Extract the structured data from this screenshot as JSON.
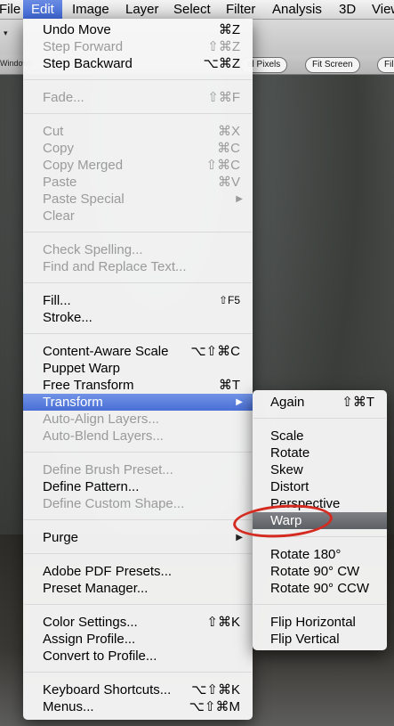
{
  "menubar": {
    "items": [
      "File",
      "Edit",
      "Image",
      "Layer",
      "Select",
      "Filter",
      "Analysis",
      "3D",
      "View"
    ],
    "active": "Edit"
  },
  "optbar": {
    "arrow": "▾",
    "window_label": "Windows",
    "actual_pixels": "al Pixels",
    "fit_screen": "Fit Screen",
    "fill_screen": "Fill"
  },
  "edit_menu": [
    {
      "label": "Undo Move",
      "shortcut": "⌘Z",
      "disabled": false
    },
    {
      "label": "Step Forward",
      "shortcut": "⇧⌘Z",
      "disabled": true
    },
    {
      "label": "Step Backward",
      "shortcut": "⌥⌘Z",
      "disabled": false
    },
    {
      "label": "Fade...",
      "shortcut": "⇧⌘F",
      "disabled": true
    },
    {
      "label": "Cut",
      "shortcut": "⌘X",
      "disabled": true
    },
    {
      "label": "Copy",
      "shortcut": "⌘C",
      "disabled": true
    },
    {
      "label": "Copy Merged",
      "shortcut": "⇧⌘C",
      "disabled": true
    },
    {
      "label": "Paste",
      "shortcut": "⌘V",
      "disabled": true
    },
    {
      "label": "Paste Special",
      "shortcut": "",
      "disabled": true
    },
    {
      "label": "Clear",
      "shortcut": "",
      "disabled": true
    },
    {
      "label": "Check Spelling...",
      "shortcut": "",
      "disabled": true
    },
    {
      "label": "Find and Replace Text...",
      "shortcut": "",
      "disabled": true
    },
    {
      "label": "Fill...",
      "shortcut": "⇧F5",
      "disabled": false
    },
    {
      "label": "Stroke...",
      "shortcut": "",
      "disabled": false
    },
    {
      "label": "Content-Aware Scale",
      "shortcut": "⌥⇧⌘C",
      "disabled": false
    },
    {
      "label": "Puppet Warp",
      "shortcut": "",
      "disabled": false
    },
    {
      "label": "Free Transform",
      "shortcut": "⌘T",
      "disabled": false
    },
    {
      "label": "Transform",
      "shortcut": "",
      "disabled": false
    },
    {
      "label": "Auto-Align Layers...",
      "shortcut": "",
      "disabled": true
    },
    {
      "label": "Auto-Blend Layers...",
      "shortcut": "",
      "disabled": true
    },
    {
      "label": "Define Brush Preset...",
      "shortcut": "",
      "disabled": true
    },
    {
      "label": "Define Pattern...",
      "shortcut": "",
      "disabled": false
    },
    {
      "label": "Define Custom Shape...",
      "shortcut": "",
      "disabled": true
    },
    {
      "label": "Purge",
      "shortcut": "",
      "disabled": false
    },
    {
      "label": "Adobe PDF Presets...",
      "shortcut": "",
      "disabled": false
    },
    {
      "label": "Preset Manager...",
      "shortcut": "",
      "disabled": false
    },
    {
      "label": "Color Settings...",
      "shortcut": "⇧⌘K",
      "disabled": false
    },
    {
      "label": "Assign Profile...",
      "shortcut": "",
      "disabled": false
    },
    {
      "label": "Convert to Profile...",
      "shortcut": "",
      "disabled": false
    },
    {
      "label": "Keyboard Shortcuts...",
      "shortcut": "⌥⇧⌘K",
      "disabled": false
    },
    {
      "label": "Menus...",
      "shortcut": "⌥⇧⌘M",
      "disabled": false
    }
  ],
  "submenu_arrow": "▶",
  "transform_submenu": [
    {
      "label": "Again",
      "shortcut": "⇧⌘T"
    },
    {
      "label": "Scale",
      "shortcut": ""
    },
    {
      "label": "Rotate",
      "shortcut": ""
    },
    {
      "label": "Skew",
      "shortcut": ""
    },
    {
      "label": "Distort",
      "shortcut": ""
    },
    {
      "label": "Perspective",
      "shortcut": ""
    },
    {
      "label": "Warp",
      "shortcut": ""
    },
    {
      "label": "Rotate 180°",
      "shortcut": ""
    },
    {
      "label": "Rotate 90° CW",
      "shortcut": ""
    },
    {
      "label": "Rotate 90° CCW",
      "shortcut": ""
    },
    {
      "label": "Flip Horizontal",
      "shortcut": ""
    },
    {
      "label": "Flip Vertical",
      "shortcut": ""
    }
  ],
  "colors": {
    "highlight": "#4a6fd6",
    "annotation": "#d42a1f"
  }
}
